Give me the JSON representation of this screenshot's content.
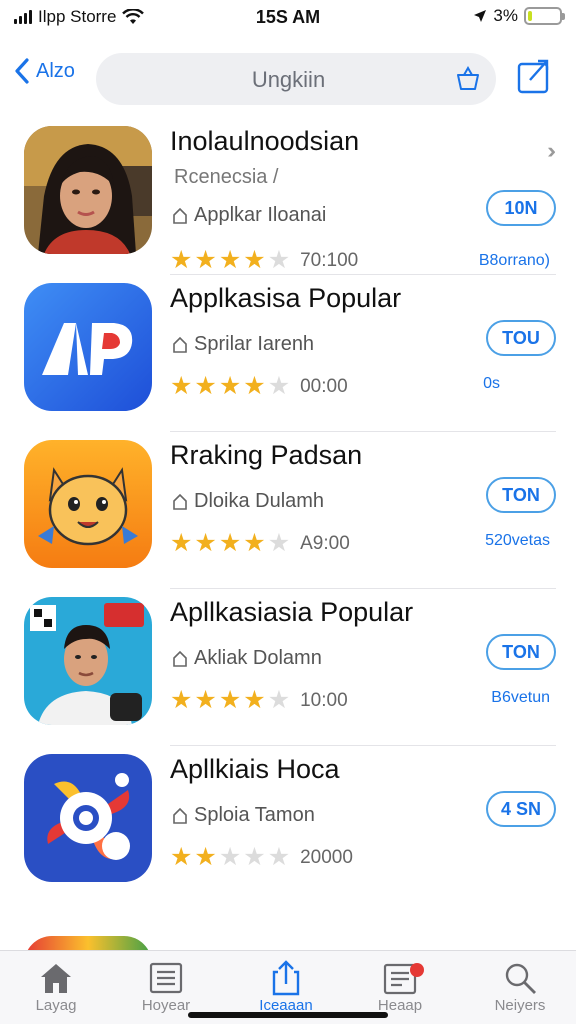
{
  "status_bar": {
    "carrier": "Ilpp Storre",
    "time": "15S AM",
    "battery_text": "3%",
    "battery_level": 0.12,
    "battery_color": "#c8e021"
  },
  "nav": {
    "back_label": "Alzo",
    "search_text": "Ungkiin",
    "search_icon": "cart-icon",
    "share_icon": "share-icon"
  },
  "apps": [
    {
      "name": "Inolaulnoodsian",
      "subtitle": "Rcenecsia /",
      "category": "Applkar Iloanai",
      "stars": 4,
      "rating_count": "70:100",
      "button": "10N",
      "size": "B8orrano)",
      "extra_badge": "›› ",
      "icon": "portrait-woman-icon"
    },
    {
      "name": "Applkasisa Popular",
      "subtitle": "",
      "category": "Sprilar Iarenh",
      "stars": 4,
      "rating_count": "00:00",
      "button": "TOU",
      "size": "0s",
      "icon": "ap-logo-icon"
    },
    {
      "name": "Rraking Padsan",
      "subtitle": "",
      "category": "Dloika Dulamh",
      "stars": 4,
      "rating_count": "A9:00",
      "button": "TON",
      "size": "520vetas",
      "icon": "cartoon-fox-icon"
    },
    {
      "name": "Apllkasiasia Popular",
      "subtitle": "",
      "category": "Akliak Dolamn",
      "stars": 4,
      "rating_count": "10:00",
      "button": "TON",
      "size": "B6vetun",
      "icon": "portrait-man-icon"
    },
    {
      "name": "Apllkiais Hoca",
      "subtitle": "",
      "category": "Sploia Tamon",
      "stars": 2,
      "rating_count": "20000",
      "button": "4 SN",
      "size": "",
      "icon": "colorful-flower-icon"
    }
  ],
  "tabs": [
    {
      "label": "Layag",
      "icon": "home-icon",
      "active": false
    },
    {
      "label": "Hoyear",
      "icon": "list-icon",
      "active": false
    },
    {
      "label": "Iceaaan",
      "icon": "share-icon",
      "active": true
    },
    {
      "label": "Heaap",
      "icon": "inbox-icon",
      "active": false
    },
    {
      "label": "Neiyers",
      "icon": "search-icon",
      "active": false
    }
  ],
  "colors": {
    "accent": "#1a73e8",
    "star": "#f2b01e",
    "badge": "#e53935"
  }
}
